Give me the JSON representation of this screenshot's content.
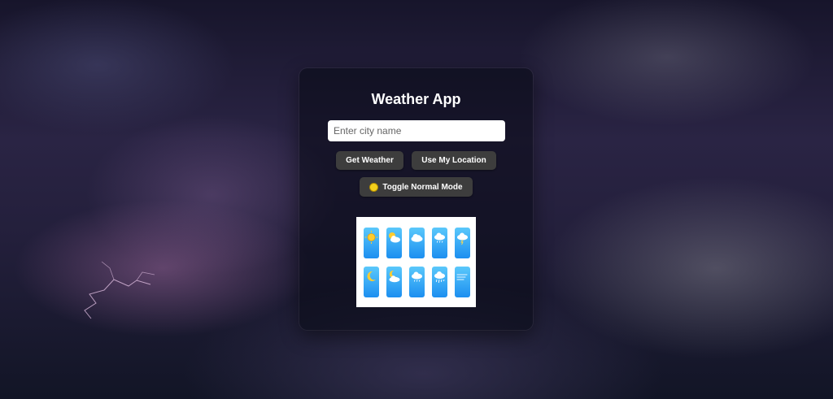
{
  "app": {
    "title": "Weather App"
  },
  "search": {
    "placeholder": "Enter city name",
    "value": ""
  },
  "buttons": {
    "get_weather": "Get Weather",
    "use_location": "Use My Location",
    "toggle_mode": "Toggle Normal Mode"
  },
  "icons": {
    "row1": [
      "sun-icon",
      "sun-cloud-icon",
      "cloud-icon",
      "rain-cloud-icon",
      "storm-cloud-icon"
    ],
    "row2": [
      "moon-icon",
      "moon-cloud-icon",
      "rain-cloud-icon",
      "heavy-rain-icon",
      "wind-icon"
    ]
  },
  "colors": {
    "button_bg": "#3d3d3d",
    "tile_gradient_top": "#5ac8fb",
    "tile_gradient_bottom": "#1c8ff0",
    "bulb": "#f4d01c"
  }
}
